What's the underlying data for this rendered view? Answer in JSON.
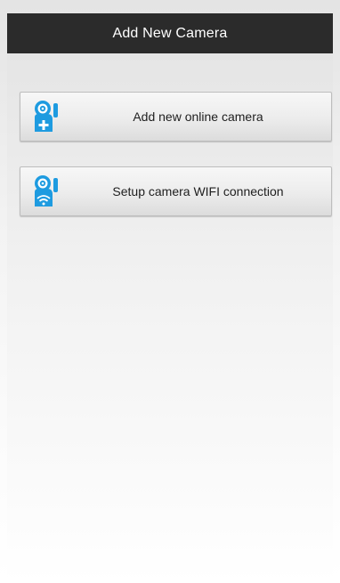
{
  "header": {
    "title": "Add New Camera"
  },
  "actions": [
    {
      "label": "Add new online camera",
      "icon": "camera-add-icon"
    },
    {
      "label": "Setup camera WIFI connection",
      "icon": "camera-wifi-icon"
    }
  ],
  "colors": {
    "titlebar_bg": "#2b2b2b",
    "icon_blue": "#1e9be0"
  }
}
